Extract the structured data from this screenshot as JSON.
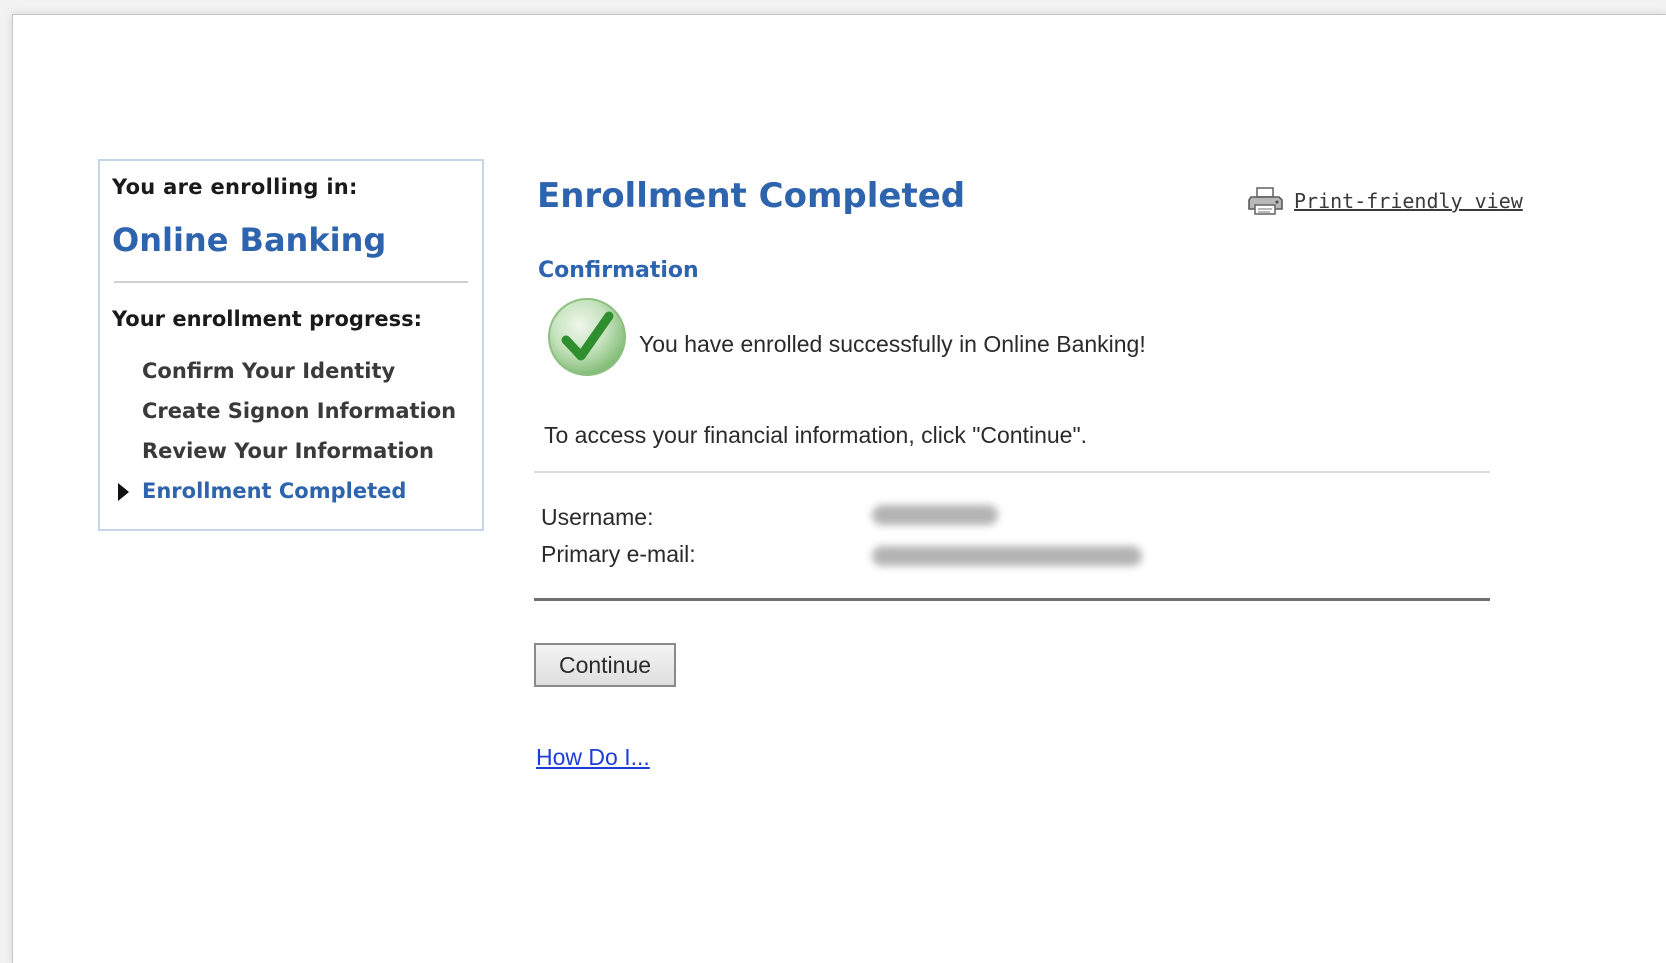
{
  "sidebar": {
    "enrolling_label": "You are enrolling in:",
    "product_name": "Online Banking",
    "progress_label": "Your enrollment progress:",
    "steps": [
      {
        "label": "Confirm Your Identity",
        "current": false
      },
      {
        "label": "Create Signon Information",
        "current": false
      },
      {
        "label": "Review Your Information",
        "current": false
      },
      {
        "label": "Enrollment Completed",
        "current": true
      }
    ]
  },
  "main": {
    "title": "Enrollment Completed",
    "print_link": "Print-friendly view",
    "section_title": "Confirmation",
    "success_message": "You have enrolled successfully in Online Banking!",
    "access_message": "To access your financial information, click \"Continue\".",
    "fields": [
      {
        "label": "Username:"
      },
      {
        "label": "Primary e-mail:"
      }
    ],
    "continue_label": "Continue",
    "help_link": "How Do I..."
  },
  "colors": {
    "accent": "#2e64ae",
    "link": "#1a3fd6",
    "success": "#3f9a3a"
  },
  "icons": {
    "print": "printer-icon",
    "success": "checkmark-icon",
    "current_step": "triangle-right-icon"
  }
}
